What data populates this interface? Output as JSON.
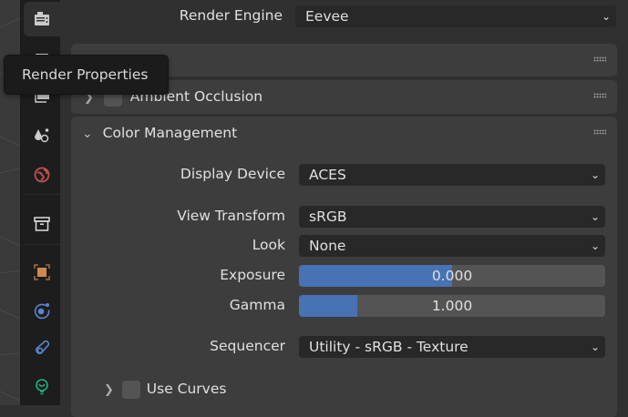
{
  "tooltip": "Render Properties",
  "sidebar": {
    "tabs": [
      "render-icon",
      "output-icon",
      "view-layer-icon",
      "scene-icon",
      "world-icon",
      "collection-icon",
      "object-icon",
      "physics-icon",
      "constraints-icon",
      "object-data-icon"
    ]
  },
  "render_engine": {
    "label": "Render Engine",
    "value": "Eevee"
  },
  "panels": {
    "ambient_occlusion": "Ambient Occlusion",
    "color_management": "Color Management"
  },
  "color_management": {
    "display_device": {
      "label": "Display Device",
      "value": "ACES"
    },
    "view_transform": {
      "label": "View Transform",
      "value": "sRGB"
    },
    "look": {
      "label": "Look",
      "value": "None"
    },
    "exposure": {
      "label": "Exposure",
      "value": "0.000",
      "fill": 0.5
    },
    "gamma": {
      "label": "Gamma",
      "value": "1.000",
      "fill": 0.19
    },
    "sequencer": {
      "label": "Sequencer",
      "value": "Utility - sRGB - Texture"
    },
    "use_curves": "Use Curves"
  },
  "colors": {
    "accent": "#4772b3"
  }
}
